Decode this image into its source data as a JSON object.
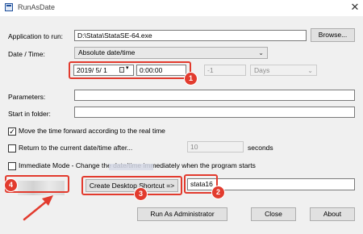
{
  "window": {
    "title": "RunAsDate",
    "close_glyph": "✕"
  },
  "app": {
    "label": "Application to run:",
    "value": "D:\\Stata\\StataSE-64.exe",
    "browse_label": "Browse..."
  },
  "datetime": {
    "label": "Date / Time:",
    "mode_value": "Absolute date/time",
    "date_value": "2019/ 5/ 1",
    "time_value": "0:00:00",
    "offset_value": "-1",
    "unit_value": "Days"
  },
  "parameters": {
    "label": "Parameters:",
    "value": ""
  },
  "start_folder": {
    "label": "Start in folder:",
    "value": ""
  },
  "options": {
    "move_forward_label": "Move the time forward according to the real time",
    "move_forward_checked": true,
    "return_label": "Return to the current date/time after...",
    "return_checked": false,
    "return_value": "10",
    "return_unit": "seconds",
    "immediate_label": "Immediate Mode - Change the date/time immediately when the program starts",
    "immediate_checked": false
  },
  "shortcut": {
    "button_label": "Create Desktop Shortcut =>",
    "name_value": "stata16"
  },
  "buttons": {
    "run_admin": "Run As Administrator",
    "close": "Close",
    "about": "About"
  },
  "annotations": {
    "badge1": "1",
    "badge2": "2",
    "badge3": "3",
    "badge4": "4",
    "accent": "#e23b2e"
  }
}
